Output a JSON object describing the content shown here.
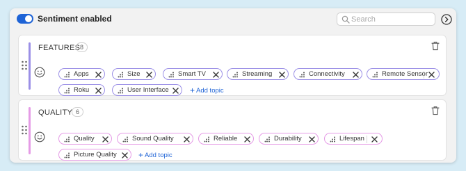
{
  "header": {
    "toggle_label": "Sentiment enabled",
    "toggle_on": true,
    "toggle_color": "#1e63d6",
    "search_placeholder": "Search",
    "search_value": ""
  },
  "sections": [
    {
      "title": "FEATURES",
      "count": "8",
      "accent_color": "#9b8fe6",
      "chips": [
        "Apps",
        "Size",
        "Smart TV",
        "Streaming",
        "Connectivity",
        "Remote Sensor",
        "Roku",
        "User Interface"
      ],
      "add_topic_label": "Add topic"
    },
    {
      "title": "QUALITY",
      "count": "6",
      "accent_color": "#e59be6",
      "chips": [
        "Quality",
        "Sound Quality",
        "Reliable",
        "Durability",
        "Lifespan",
        "Picture Quality"
      ],
      "add_topic_label": "Add topic"
    }
  ],
  "icons": {
    "search": "search-icon",
    "nav": "arrow-right-circle-icon",
    "handle": "drag-handle-icon",
    "smiley": "smiley-icon",
    "trash": "trash-icon",
    "chip_grip": "dots-grip-icon",
    "chip_close": "close-icon"
  }
}
